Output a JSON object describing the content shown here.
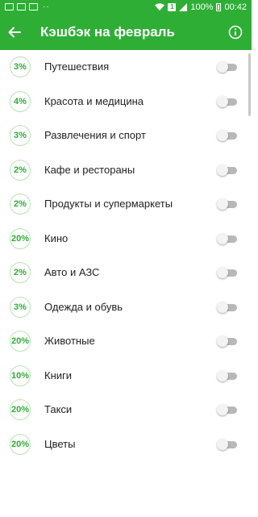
{
  "status_bar": {
    "battery": "100%",
    "time": "00:42",
    "sim": "1"
  },
  "toolbar": {
    "title": "Кэшбэк на февраль"
  },
  "categories": [
    {
      "percent": "3%",
      "name": "Путешествия",
      "enabled": false
    },
    {
      "percent": "4%",
      "name": "Красота и медицина",
      "enabled": false
    },
    {
      "percent": "3%",
      "name": "Развлечения и спорт",
      "enabled": false
    },
    {
      "percent": "2%",
      "name": "Кафе и рестораны",
      "enabled": false
    },
    {
      "percent": "2%",
      "name": "Продукты и супермаркеты",
      "enabled": false
    },
    {
      "percent": "20%",
      "name": "Кино",
      "enabled": false
    },
    {
      "percent": "2%",
      "name": "Авто и АЗС",
      "enabled": false
    },
    {
      "percent": "3%",
      "name": "Одежда и обувь",
      "enabled": false
    },
    {
      "percent": "20%",
      "name": "Животные",
      "enabled": false
    },
    {
      "percent": "10%",
      "name": "Книги",
      "enabled": false
    },
    {
      "percent": "20%",
      "name": "Такси",
      "enabled": false
    },
    {
      "percent": "20%",
      "name": "Цветы",
      "enabled": false
    }
  ],
  "colors": {
    "accent": "#2eae35",
    "badge_border": "#b9e3b4",
    "toggle_off_track": "#b8b8b8"
  }
}
